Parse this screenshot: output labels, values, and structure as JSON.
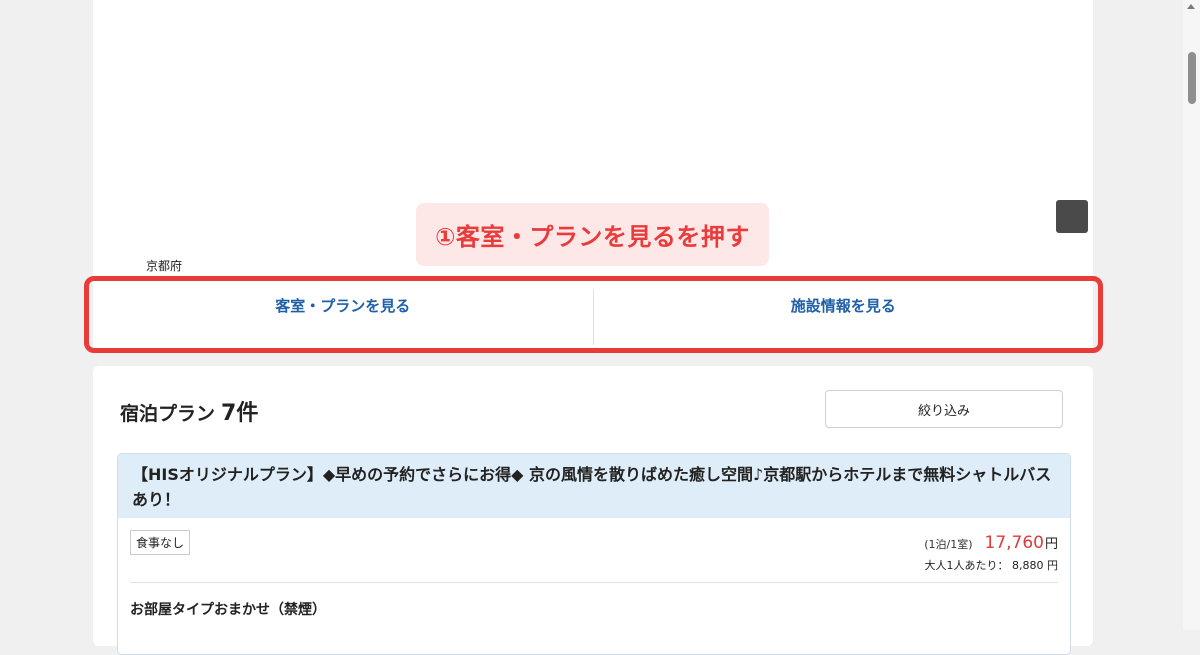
{
  "map": {
    "prefecture": "京都府"
  },
  "callout": {
    "text": "①客室・プランを見るを押す",
    "color": "#ea3b3b"
  },
  "tabs": [
    {
      "label": "客室・プランを見る"
    },
    {
      "label": "施設情報を見る"
    }
  ],
  "plans": {
    "title": "宿泊プラン",
    "count": "7件",
    "filter_label": "絞り込み",
    "items": [
      {
        "name": "【HISオリジナルプラン】◆早めの予約でさらにお得◆ 京の風情を散りばめた癒し空間♪京都駅からホテルまで無料シャトルバスあり！",
        "meal": "食事なし",
        "price_note": "(1泊/1室)",
        "price": "17,760",
        "price_unit": "円",
        "per_person": "大人1人あたり： 8,880 円",
        "room_type": "お部屋タイプおまかせ（禁煙）"
      }
    ]
  },
  "colors": {
    "accent_red": "#ea3b3b",
    "link_blue": "#1f5fa8",
    "header_bg": "#deedf7",
    "price_red": "#e03a3a"
  }
}
